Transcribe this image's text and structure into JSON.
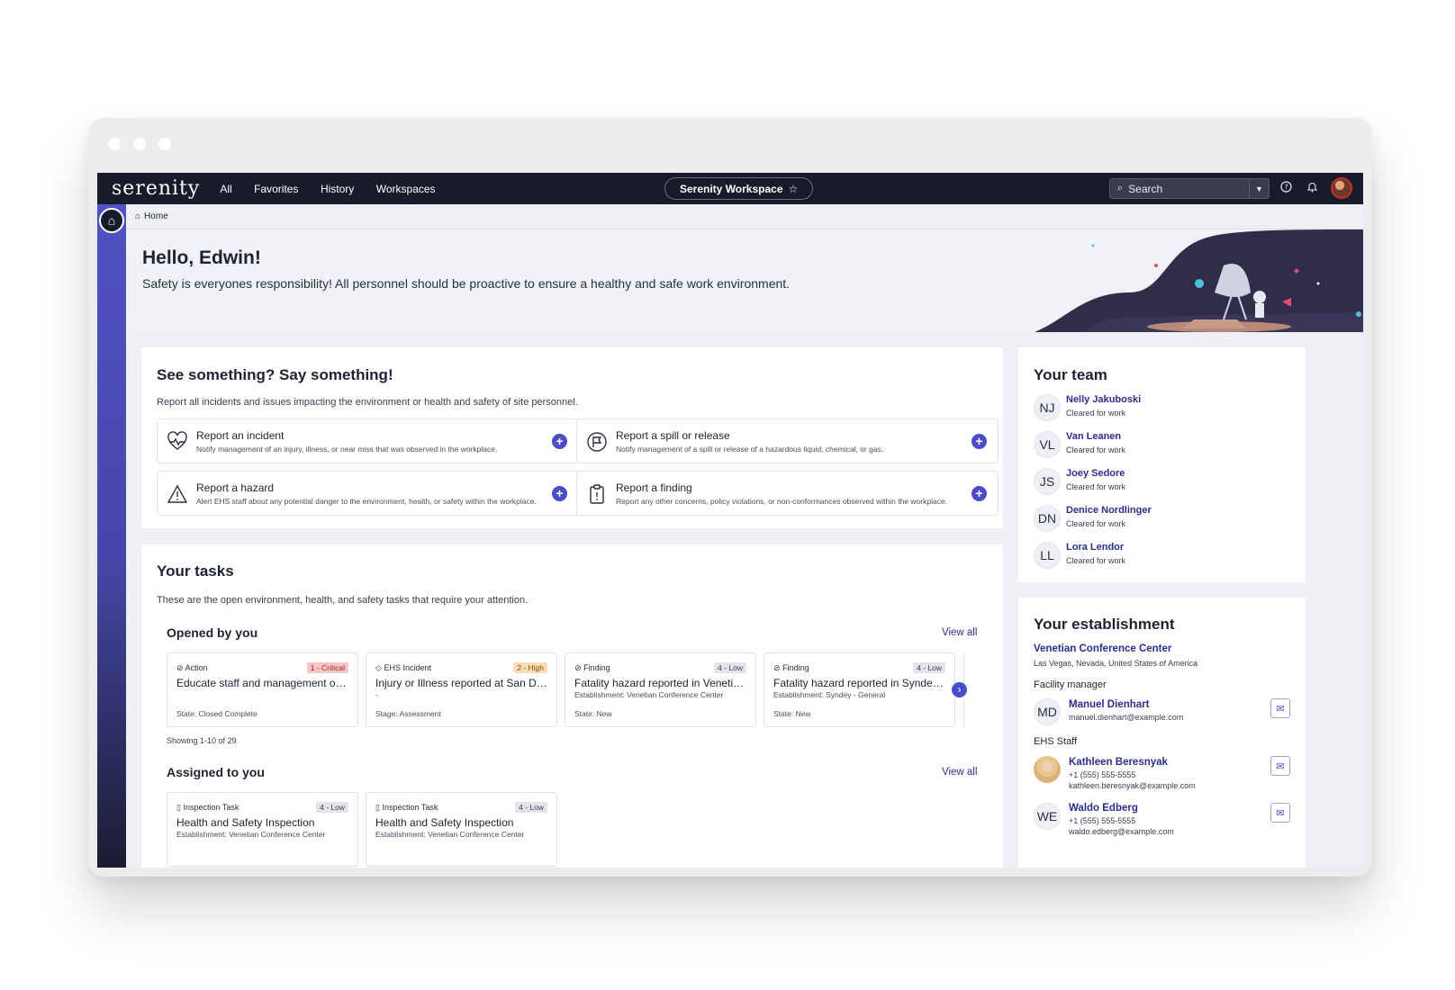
{
  "topbar": {
    "logo": "serenity",
    "nav": [
      "All",
      "Favorites",
      "History",
      "Workspaces"
    ],
    "workspace": "Serenity Workspace",
    "search_label": "Search"
  },
  "breadcrumb": "Home",
  "hero": {
    "greeting": "Hello, Edwin!",
    "message": "Safety is everyones responsibility! All personnel should be proactive to ensure a healthy and safe work environment."
  },
  "report_section": {
    "title": "See something? Say something!",
    "subtitle": "Report all incidents and issues impacting the environment or health and safety of site personnel.",
    "items": [
      {
        "title": "Report an incident",
        "desc": "Notify management of an injury, illness, or near miss that was observed in the workplace.",
        "icon": "heartbeat-icon"
      },
      {
        "title": "Report a spill or release",
        "desc": "Notify management of a spill or release of a hazardous liquid, chemical, or gas.",
        "icon": "flag-icon"
      },
      {
        "title": "Report a hazard",
        "desc": "Alert EHS staff about any potential danger to the environment, health, or safety within the workplace.",
        "icon": "warning-icon"
      },
      {
        "title": "Report a finding",
        "desc": "Report any other concerns, policy violations, or non-conformances observed within the workplace.",
        "icon": "clipboard-icon"
      }
    ]
  },
  "tasks": {
    "title": "Your tasks",
    "subtitle": "These are the open environment, health, and safety tasks that require your attention.",
    "opened": {
      "title": "Opened by you",
      "view_all": "View all",
      "showing": "Showing 1-10 of 29",
      "items": [
        {
          "type": "Action",
          "priority": "1 - Critical",
          "title": "Educate staff and management on g...",
          "sub": "",
          "state": "State:  Closed Complete",
          "icon": "check-circle-icon"
        },
        {
          "type": "EHS Incident",
          "priority": "2 - High",
          "title": "Injury or Illness reported at San Dieg...",
          "sub": "-",
          "state": "Stage:  Assessment",
          "icon": "incident-icon"
        },
        {
          "type": "Finding",
          "priority": "4 - Low",
          "title": "Fatality hazard reported in Venetian ...",
          "sub": "Establishment: Venetian Conference Center",
          "state": "State:  New",
          "icon": "check-circle-icon"
        },
        {
          "type": "Finding",
          "priority": "4 - Low",
          "title": "Fatality hazard reported in Syndey - ...",
          "sub": "Establishment: Syndey - General",
          "state": "State:  New",
          "icon": "check-circle-icon"
        }
      ]
    },
    "assigned": {
      "title": "Assigned to you",
      "view_all": "View all",
      "items": [
        {
          "type": "Inspection Task",
          "priority": "4 - Low",
          "title": "Health and Safety Inspection",
          "sub": "Establishment: Venetian Conference Center"
        },
        {
          "type": "Inspection Task",
          "priority": "4 - Low",
          "title": "Health and Safety Inspection",
          "sub": "Establishment: Venetian Conference Center"
        }
      ]
    }
  },
  "team": {
    "title": "Your team",
    "members": [
      {
        "initials": "NJ",
        "name": "Nelly Jakuboski",
        "status": "Cleared for work"
      },
      {
        "initials": "VL",
        "name": "Van Leanen",
        "status": "Cleared for work"
      },
      {
        "initials": "JS",
        "name": "Joey Sedore",
        "status": "Cleared for work"
      },
      {
        "initials": "DN",
        "name": "Denice Nordlinger",
        "status": "Cleared for work"
      },
      {
        "initials": "LL",
        "name": "Lora Lendor",
        "status": "Cleared for work"
      }
    ]
  },
  "establishment": {
    "title": "Your establishment",
    "name": "Venetian Conference Center",
    "location": "Las Vegas, Nevada, United States of America",
    "manager_label": "Facility manager",
    "manager": {
      "initials": "MD",
      "name": "Manuel Dienhart",
      "email": "manuel.dienhart@example.com"
    },
    "staff_label": "EHS Staff",
    "staff": [
      {
        "initials": "",
        "name": "Kathleen Beresnyak",
        "phone": "+1 (555) 555-5555",
        "email": "kathleen.beresnyak@example.com"
      },
      {
        "initials": "WE",
        "name": "Waldo Edberg",
        "phone": "+1 (555) 555-5555",
        "email": "waldo.edberg@example.com"
      }
    ]
  },
  "colors": {
    "accent": "#4a4cc9",
    "navbar": "#191b2c",
    "link": "#2b2d8f",
    "critical": "#f6c6c6",
    "high": "#fbdcb6"
  }
}
